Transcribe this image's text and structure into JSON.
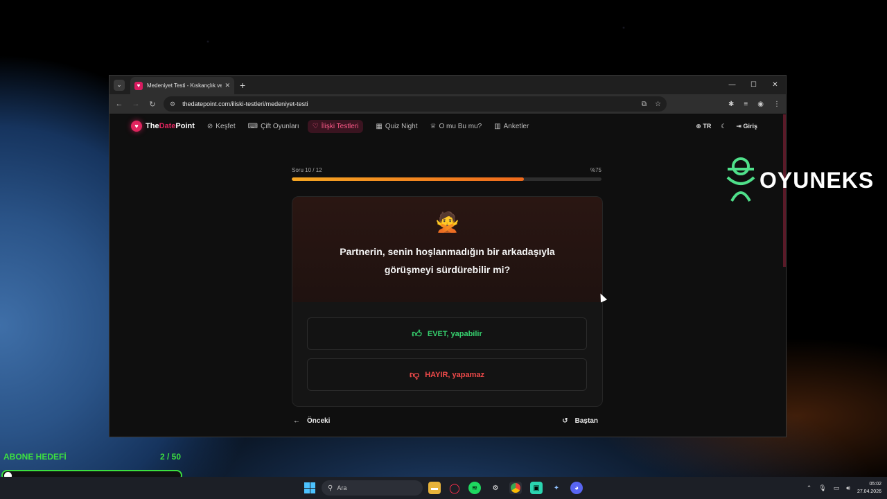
{
  "browser": {
    "tab_title": "Medeniyet Testi - Kıskançlık ve",
    "url": "thedatepoint.com/iliski-testleri/medeniyet-testi"
  },
  "site": {
    "logo_the": "The",
    "logo_date": "Date",
    "logo_point": "Point",
    "nav": [
      {
        "label": "Keşfet",
        "icon": "compass-icon"
      },
      {
        "label": "Çift Oyunları",
        "icon": "gamepad-icon"
      },
      {
        "label": "İlişki Testleri",
        "icon": "heart-icon",
        "active": true
      },
      {
        "label": "Quiz Night",
        "icon": "grid-icon"
      },
      {
        "label": "O mu Bu mu?",
        "icon": "trophy-icon"
      },
      {
        "label": "Anketler",
        "icon": "bar-chart-icon"
      }
    ],
    "lang": "TR",
    "login": "Giriş"
  },
  "quiz": {
    "question_counter": "Soru 10 / 12",
    "percent_label": "%75",
    "progress": 0.75,
    "emoji": "🙅",
    "question": "Partnerin, senin hoşlanmadığın bir arkadaşıyla görüşmeyi sürdürebilir mi?",
    "yes_label": "EVET, yapabilir",
    "no_label": "HAYIR, yapamaz",
    "prev_label": "Önceki",
    "restart_label": "Baştan",
    "colors": {
      "yes": "#36d06e",
      "no": "#f04a4a",
      "progress": "#ef6a1c"
    }
  },
  "overlay": {
    "brand": "OYUNEKS",
    "goal_label": "ABONE HEDEFİ",
    "goal_count": "2 / 50",
    "goal_progress": 0.04
  },
  "taskbar": {
    "search_placeholder": "Ara",
    "time": "05:02",
    "date": "27.04.2026"
  }
}
